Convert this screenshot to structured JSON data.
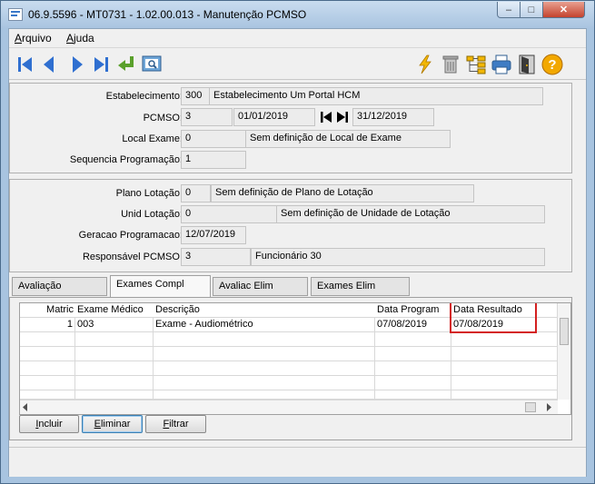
{
  "window": {
    "title": "06.9.5596 - MT0731 - 1.02.00.013 - Manutenção PCMSO",
    "minimize_glyph": "–",
    "maximize_glyph": "□",
    "close_glyph": "✕"
  },
  "menu": [
    {
      "first": "A",
      "rest": "rquivo"
    },
    {
      "first": "A",
      "rest": "juda"
    }
  ],
  "toolbar": {
    "left_icons": [
      "first-record-icon",
      "previous-record-icon",
      "next-record-icon",
      "last-record-icon",
      "go-to-icon",
      "search-icon"
    ],
    "right_icons": [
      "lightning-icon",
      "trash-icon",
      "tree-icon",
      "printer-icon",
      "exit-door-icon",
      "help-icon"
    ],
    "help_glyph": "?"
  },
  "header_panel": {
    "estabelecimento_label": "Estabelecimento:",
    "estabelecimento_code": "300",
    "estabelecimento_name": "Estabelecimento Um Portal HCM",
    "pcmso_label": "PCMSO:",
    "pcmso_code": "3",
    "pcmso_start": "01/01/2019",
    "pcmso_end": "31/12/2019",
    "local_exame_label": "Local Exame:",
    "local_exame_code": "0",
    "local_exame_name": "Sem definição de Local de Exame",
    "sequencia_label": "Sequencia Programação:",
    "sequencia_value": "1"
  },
  "detail_panel": {
    "plano_label": "Plano Lotação:",
    "plano_code": "0",
    "plano_name": "Sem definição de Plano de Lotação",
    "unid_label": "Unid Lotação:",
    "unid_code": "0",
    "unid_name": "Sem definição de Unidade de Lotação",
    "geracao_label": "Geracao Programacao:",
    "geracao_value": "12/07/2019",
    "responsavel_label": "Responsável PCMSO:",
    "responsavel_code": "3",
    "responsavel_name": "Funcionário 30"
  },
  "tabs": [
    "Avaliação",
    "Exames Compl",
    "Avaliac Elim",
    "Exames Elim"
  ],
  "active_tab": "Exames Compl",
  "grid": {
    "columns": [
      "Matric",
      "Exame Médico",
      "Descrição",
      "Data Program",
      "Data Resultado"
    ],
    "rows": [
      [
        "1",
        "003",
        "Exame - Audiométrico",
        "07/08/2019",
        "07/08/2019"
      ]
    ]
  },
  "buttons": {
    "incluir_first": "I",
    "incluir_rest": "ncluir",
    "eliminar_first": "E",
    "eliminar_rest": "liminar",
    "filtrar_first": "F",
    "filtrar_rest": "iltrar"
  },
  "colors": {
    "highlight": "#d42020",
    "nav_blue": "#2f6fd0",
    "go_green": "#5aa02c"
  }
}
